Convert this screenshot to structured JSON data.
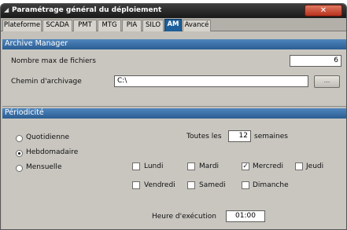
{
  "window": {
    "title": "Paramétrage général du déploiement",
    "close_glyph": "✕"
  },
  "tabs": [
    {
      "label": "Plateforme"
    },
    {
      "label": "SCADA"
    },
    {
      "label": "PMT"
    },
    {
      "label": "MTG"
    },
    {
      "label": "PIA"
    },
    {
      "label": "SILO"
    },
    {
      "label": "AM",
      "active": true
    },
    {
      "label": "Avancé"
    }
  ],
  "archive": {
    "header": "Archive Manager",
    "max_files_label": "Nombre max de fichiers",
    "max_files_value": "6",
    "path_label": "Chemin d'archivage",
    "path_value": "C:\\",
    "browse_label": "..."
  },
  "periodicity": {
    "header": "Périodicité",
    "options": [
      {
        "label": "Quotidienne",
        "checked": false
      },
      {
        "label": "Hebdomadaire",
        "checked": true
      },
      {
        "label": "Mensuelle",
        "checked": false
      }
    ],
    "every_label": "Toutes les",
    "every_value": "12",
    "weeks_label": "semaines",
    "days": [
      {
        "label": "Lundi",
        "checked": false
      },
      {
        "label": "Mardi",
        "checked": false
      },
      {
        "label": "Mercredi",
        "checked": true
      },
      {
        "label": "Jeudi",
        "checked": false
      },
      {
        "label": "Vendredi",
        "checked": false
      },
      {
        "label": "Samedi",
        "checked": false
      },
      {
        "label": "Dimanche",
        "checked": false
      }
    ],
    "exec_time_label": "Heure d'exécution",
    "exec_time_value": "01:00"
  }
}
